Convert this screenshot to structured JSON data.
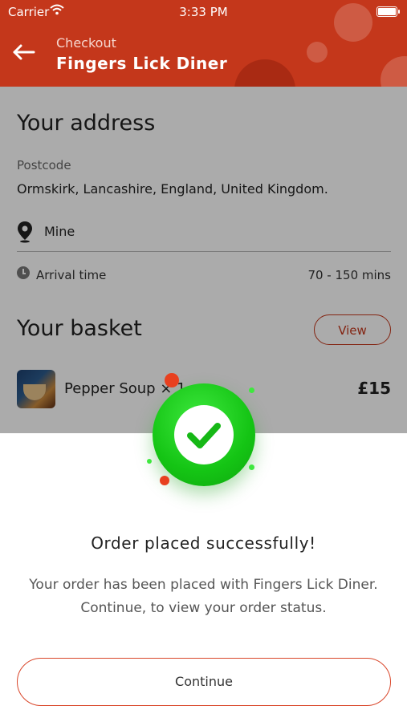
{
  "status_bar": {
    "carrier": "Carrier",
    "time": "3:33 PM"
  },
  "header": {
    "subtitle": "Checkout",
    "title": "Fingers Lick Diner"
  },
  "address": {
    "heading": "Your address",
    "postcode_label": "Postcode",
    "postcode_value": "Ormskirk, Lancashire, England, United Kingdom.",
    "location_name": "Mine",
    "arrival_label": "Arrival time",
    "arrival_value": "70 - 150 mins"
  },
  "basket": {
    "heading": "Your basket",
    "view_label": "View",
    "items": [
      {
        "name": "Pepper Soup × 1",
        "price": "£15"
      }
    ]
  },
  "modal": {
    "title": "Order placed successfully!",
    "message": "Your order has been placed with Fingers Lick Diner. Continue, to view your order status.",
    "continue_label": "Continue"
  },
  "colors": {
    "brand": "#c4371b",
    "success": "#1ac41a"
  },
  "icons": [
    "back-arrow-icon",
    "wifi-icon",
    "battery-icon",
    "location-pin-icon",
    "clock-icon",
    "checkmark-icon"
  ]
}
